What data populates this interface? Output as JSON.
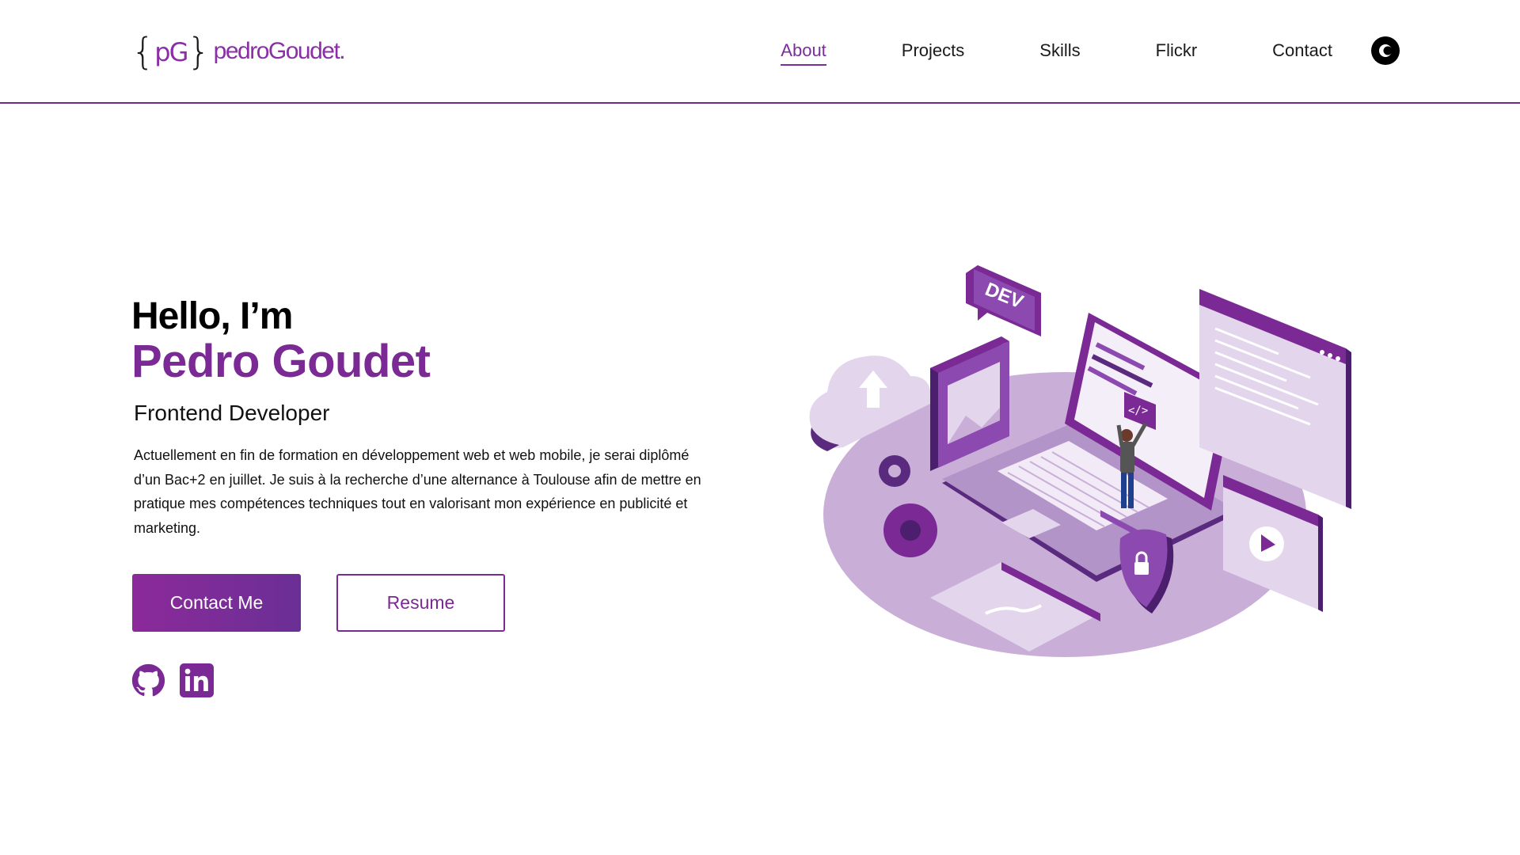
{
  "header": {
    "logo": {
      "mark_left": "{",
      "mark_initials": "pG",
      "mark_right": "}",
      "name": "pedroGoudet."
    },
    "nav": [
      {
        "label": "About",
        "active": true
      },
      {
        "label": "Projects",
        "active": false
      },
      {
        "label": "Skills",
        "active": false
      },
      {
        "label": "Flickr",
        "active": false
      },
      {
        "label": "Contact",
        "active": false
      }
    ],
    "theme_toggle_icon": "dark-mode-icon"
  },
  "hero": {
    "greeting": "Hello, I’m",
    "name": "Pedro Goudet",
    "role": "Frontend Developer",
    "description": "Actuellement en fin de formation en développement web et web mobile, je serai diplômé d’un Bac+2 en juillet. Je suis à la recherche d’une alternance à Toulouse afin de mettre en pratique mes compétences techniques tout en valorisant mon expérience en publicité et marketing.",
    "contact_button": "Contact Me",
    "resume_button": "Resume"
  },
  "social": [
    {
      "icon": "github-icon"
    },
    {
      "icon": "linkedin-icon"
    }
  ],
  "illustration": {
    "dev_badge": "DEV",
    "code_badge": "</>"
  },
  "colors": {
    "accent": "#7b2a95",
    "accent_light": "#c9aed8",
    "accent_dark": "#4b1e6e"
  }
}
